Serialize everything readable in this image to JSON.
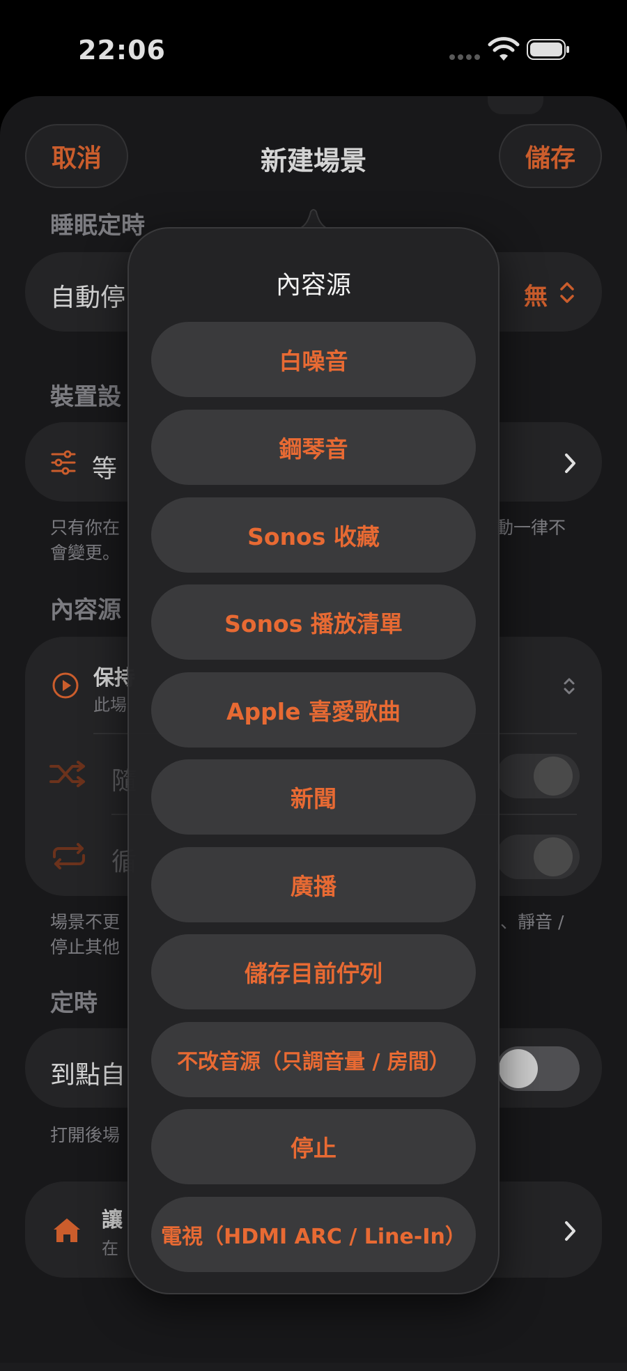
{
  "status": {
    "time": "22:06"
  },
  "nav": {
    "cancel": "取消",
    "title": "新建場景",
    "save": "儲存"
  },
  "background": {
    "sleep_timer": {
      "header": "睡眠定時",
      "row_label": "自動停",
      "row_value": "無"
    },
    "device": {
      "header": "裝置設",
      "row_label": "等",
      "footer_left": "只有你在",
      "footer_left2": "會變更。",
      "footer_right": "動一律不"
    },
    "content_source": {
      "header": "內容源",
      "keep_title": "保持",
      "keep_sub": "此場",
      "shuffle_label": "隨",
      "repeat_label": "循",
      "footer_left": "場景不更",
      "footer_left2": "停止其他",
      "footer_right": "、靜音 /"
    },
    "timer": {
      "header": "定時",
      "row_label": "到點自",
      "footer": "打開後場"
    },
    "home": {
      "title": "讓",
      "subtitle": "在"
    }
  },
  "popover": {
    "title": "內容源",
    "options": [
      "白噪音",
      "鋼琴音",
      "Sonos 收藏",
      "Sonos 播放清單",
      "Apple 喜愛歌曲",
      "新聞",
      "廣播",
      "儲存目前佇列",
      "不改音源（只調音量 / 房間）",
      "停止",
      "電視（HDMI ARC / Line-In）"
    ]
  },
  "colors": {
    "accent": "#e86a33",
    "sheet": "#1c1c1e",
    "card": "#2a2a2c"
  }
}
